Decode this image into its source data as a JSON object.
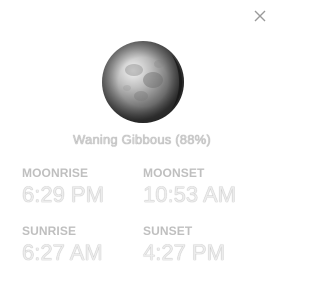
{
  "phase_name": "Waning Gibbous (88%)",
  "illumination_percent": 88,
  "moonrise": {
    "label": "MOONRISE",
    "time": "6:29 PM"
  },
  "moonset": {
    "label": "MOONSET",
    "time": "10:53 AM"
  },
  "sunrise": {
    "label": "SUNRISE",
    "time": "6:27 AM"
  },
  "sunset": {
    "label": "SUNSET",
    "time": "4:27 PM"
  },
  "icons": {
    "close": "close-icon",
    "moon": "moon-phase-icon"
  },
  "colors": {
    "background": "#ffffff",
    "label": "#bfbfbf",
    "value": "#ececec",
    "close": "#9a9a9a"
  }
}
